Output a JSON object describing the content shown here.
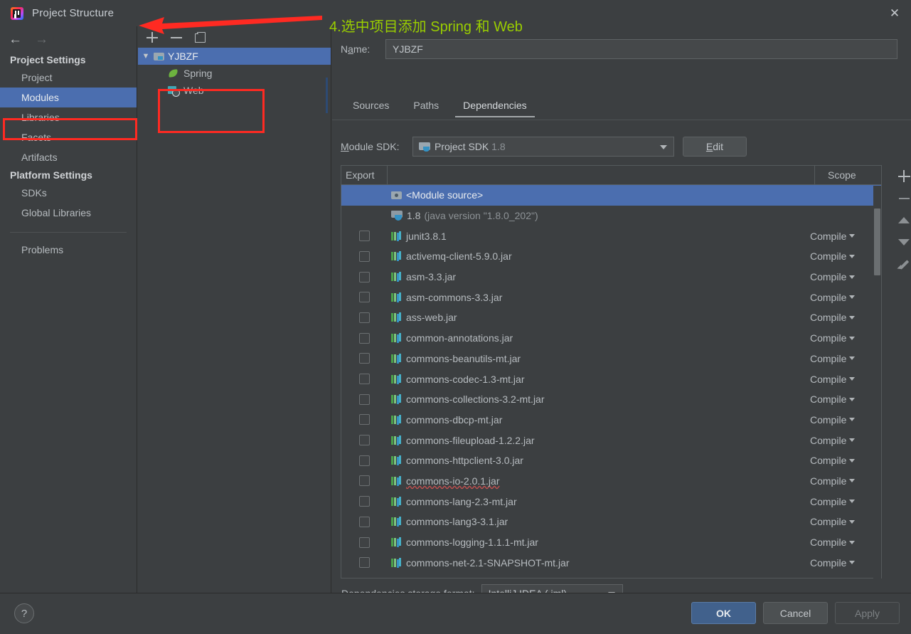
{
  "window": {
    "title": "Project Structure",
    "logo_icon": "intellij-idea-logo-icon",
    "close_icon": "close-icon"
  },
  "annotation": {
    "text": "4.选中项目添加 Spring 和 Web",
    "color": "#9ace00",
    "arrow_color": "#ff2a22",
    "highlight_color": "#ff2a22"
  },
  "sidebar": {
    "back_icon": "arrow-left-icon",
    "forward_icon": "arrow-right-icon",
    "groups": [
      {
        "title": "Project Settings",
        "items": [
          {
            "label": "Project",
            "selected": false
          },
          {
            "label": "Modules",
            "selected": true
          },
          {
            "label": "Libraries",
            "selected": false
          },
          {
            "label": "Facets",
            "selected": false
          },
          {
            "label": "Artifacts",
            "selected": false
          }
        ]
      },
      {
        "title": "Platform Settings",
        "items": [
          {
            "label": "SDKs",
            "selected": false
          },
          {
            "label": "Global Libraries",
            "selected": false
          }
        ]
      }
    ],
    "problems_label": "Problems"
  },
  "tree_panel": {
    "toolbar": [
      {
        "name": "add-module-button",
        "icon": "plus-icon"
      },
      {
        "name": "remove-module-button",
        "icon": "minus-icon"
      },
      {
        "name": "copy-module-button",
        "icon": "copy-icon"
      }
    ],
    "nodes": [
      {
        "label": "YJBZF",
        "icon": "folder-module-icon",
        "selected": true,
        "expanded": true,
        "level": 0
      },
      {
        "label": "Spring",
        "icon": "spring-facet-icon",
        "selected": false,
        "level": 1
      },
      {
        "label": "Web",
        "icon": "web-facet-icon",
        "selected": false,
        "level": 1
      }
    ]
  },
  "editor": {
    "name_label": "Name:",
    "name_value": "YJBZF",
    "tabs": [
      {
        "label": "Sources",
        "active": false
      },
      {
        "label": "Paths",
        "active": false
      },
      {
        "label": "Dependencies",
        "active": true
      }
    ],
    "sdk_label": "Module SDK:",
    "sdk_value": "Project SDK",
    "sdk_version": "1.8",
    "sdk_icon": "jdk-folder-icon",
    "edit_button": "Edit",
    "table": {
      "columns": [
        "Export",
        "",
        "Scope"
      ],
      "rows": [
        {
          "name": "<Module source>",
          "icon": "module-source-icon",
          "scope": "",
          "checkbox": false,
          "selected": true,
          "suffix": ""
        },
        {
          "name": "1.8",
          "icon": "jdk-icon",
          "scope": "",
          "checkbox": false,
          "selected": false,
          "suffix": "(java version \"1.8.0_202\")"
        },
        {
          "name": "junit3.8.1",
          "icon": "library-icon",
          "scope": "Compile",
          "checkbox": true,
          "selected": false,
          "suffix": ""
        },
        {
          "name": "activemq-client-5.9.0.jar",
          "icon": "library-icon",
          "scope": "Compile",
          "checkbox": true,
          "selected": false,
          "suffix": ""
        },
        {
          "name": "asm-3.3.jar",
          "icon": "library-icon",
          "scope": "Compile",
          "checkbox": true,
          "selected": false,
          "suffix": ""
        },
        {
          "name": "asm-commons-3.3.jar",
          "icon": "library-icon",
          "scope": "Compile",
          "checkbox": true,
          "selected": false,
          "suffix": ""
        },
        {
          "name": "ass-web.jar",
          "icon": "library-icon",
          "scope": "Compile",
          "checkbox": true,
          "selected": false,
          "suffix": ""
        },
        {
          "name": "common-annotations.jar",
          "icon": "library-icon",
          "scope": "Compile",
          "checkbox": true,
          "selected": false,
          "suffix": ""
        },
        {
          "name": "commons-beanutils-mt.jar",
          "icon": "library-icon",
          "scope": "Compile",
          "checkbox": true,
          "selected": false,
          "suffix": ""
        },
        {
          "name": "commons-codec-1.3-mt.jar",
          "icon": "library-icon",
          "scope": "Compile",
          "checkbox": true,
          "selected": false,
          "suffix": ""
        },
        {
          "name": "commons-collections-3.2-mt.jar",
          "icon": "library-icon",
          "scope": "Compile",
          "checkbox": true,
          "selected": false,
          "suffix": ""
        },
        {
          "name": "commons-dbcp-mt.jar",
          "icon": "library-icon",
          "scope": "Compile",
          "checkbox": true,
          "selected": false,
          "suffix": ""
        },
        {
          "name": "commons-fileupload-1.2.2.jar",
          "icon": "library-icon",
          "scope": "Compile",
          "checkbox": true,
          "selected": false,
          "suffix": ""
        },
        {
          "name": "commons-httpclient-3.0.jar",
          "icon": "library-icon",
          "scope": "Compile",
          "checkbox": true,
          "selected": false,
          "suffix": ""
        },
        {
          "name": "commons-io-2.0.1.jar",
          "icon": "library-icon",
          "scope": "Compile",
          "checkbox": true,
          "selected": false,
          "suffix": "",
          "squiggle": true
        },
        {
          "name": "commons-lang-2.3-mt.jar",
          "icon": "library-icon",
          "scope": "Compile",
          "checkbox": true,
          "selected": false,
          "suffix": ""
        },
        {
          "name": "commons-lang3-3.1.jar",
          "icon": "library-icon",
          "scope": "Compile",
          "checkbox": true,
          "selected": false,
          "suffix": ""
        },
        {
          "name": "commons-logging-1.1.1-mt.jar",
          "icon": "library-icon",
          "scope": "Compile",
          "checkbox": true,
          "selected": false,
          "suffix": ""
        },
        {
          "name": "commons-net-2.1-SNAPSHOT-mt.jar",
          "icon": "library-icon",
          "scope": "Compile",
          "checkbox": true,
          "selected": false,
          "suffix": ""
        }
      ]
    },
    "tools": [
      {
        "name": "add-dependency-button",
        "icon": "plus-icon"
      },
      {
        "name": "remove-dependency-button",
        "icon": "minus-icon"
      },
      {
        "name": "move-up-button",
        "icon": "arrow-up-icon"
      },
      {
        "name": "move-down-button",
        "icon": "arrow-down-icon"
      },
      {
        "name": "edit-dependency-button",
        "icon": "pencil-icon"
      }
    ],
    "storage_label": "Dependencies storage format:",
    "storage_value": "IntelliJ IDEA (.iml)"
  },
  "footer": {
    "help_icon": "help-question-icon",
    "ok": "OK",
    "cancel": "Cancel",
    "apply": "Apply"
  }
}
